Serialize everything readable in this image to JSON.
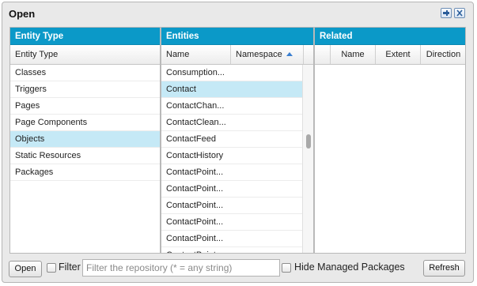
{
  "window": {
    "title": "Open"
  },
  "panels": {
    "entity_type": {
      "header": "Entity Type",
      "column": "Entity Type",
      "rows": [
        "Classes",
        "Triggers",
        "Pages",
        "Page Components",
        "Objects",
        "Static Resources",
        "Packages"
      ],
      "selected": "Objects"
    },
    "entities": {
      "header": "Entities",
      "columns": {
        "name": "Name",
        "namespace": "Namespace"
      },
      "rows": [
        "Consumption...",
        "Contact",
        "ContactChan...",
        "ContactClean...",
        "ContactFeed",
        "ContactHistory",
        "ContactPoint...",
        "ContactPoint...",
        "ContactPoint...",
        "ContactPoint...",
        "ContactPoint...",
        "ContactPoint..."
      ],
      "selected": "Contact"
    },
    "related": {
      "header": "Related",
      "columns": {
        "name": "Name",
        "extent": "Extent",
        "direction": "Direction"
      }
    }
  },
  "footer": {
    "open_label": "Open",
    "filter_label": "Filter",
    "filter_placeholder": "Filter the repository (* = any string)",
    "hide_managed_label": "Hide Managed Packages",
    "refresh_label": "Refresh"
  },
  "colors": {
    "header_bg": "#0b99c8",
    "selection_bg": "#c5e9f6"
  }
}
